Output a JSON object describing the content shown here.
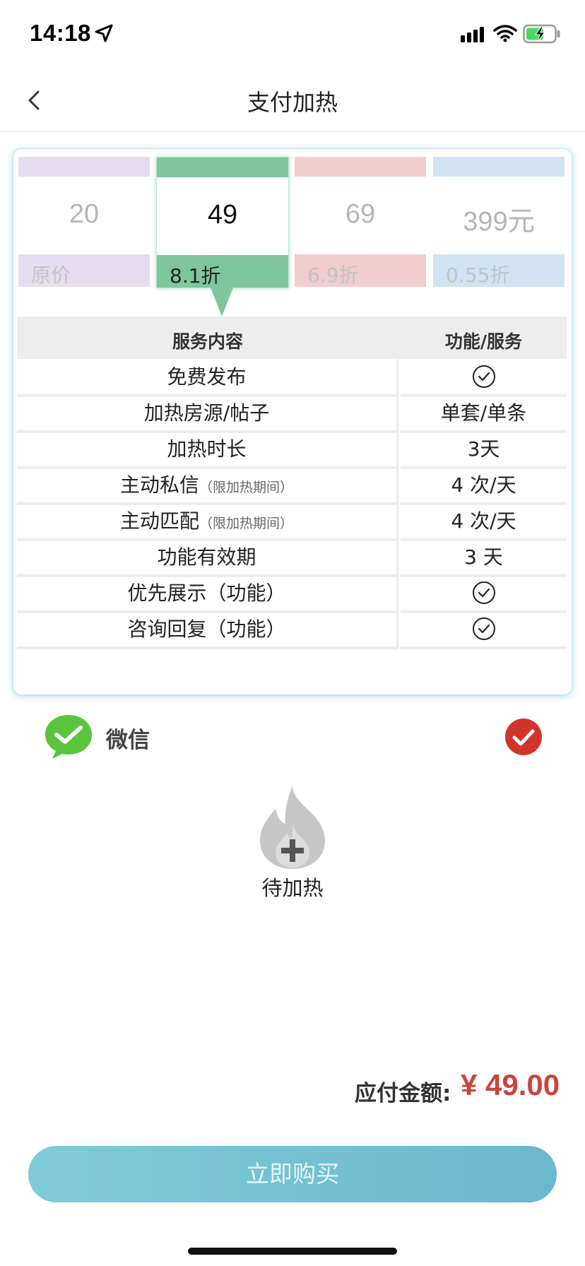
{
  "status_bar": {
    "time": "14:18"
  },
  "nav": {
    "title": "支付加热"
  },
  "tiers": [
    {
      "price": "20",
      "discount": "原价",
      "color_top": "#e6def0",
      "color_bottom": "#e6def0",
      "selected": false
    },
    {
      "price": "49",
      "discount": "8.1折",
      "color_top": "#7fc69c",
      "color_bottom": "#7fc69c",
      "selected": true
    },
    {
      "price": "69",
      "discount": "6.9折",
      "color_top": "#f0cdcf",
      "color_bottom": "#f0cdcf",
      "selected": false
    },
    {
      "price": "399元",
      "discount": "0.55折",
      "color_top": "#cfe3f3",
      "color_bottom": "#cfe3f3",
      "selected": false
    }
  ],
  "table": {
    "headers": [
      "服务内容",
      "功能/服务"
    ],
    "rows": [
      {
        "label": "免费发布",
        "note": "",
        "value": "",
        "check": true
      },
      {
        "label": "加热房源/帖子",
        "note": "",
        "value": "单套/单条",
        "check": false
      },
      {
        "label": "加热时长",
        "note": "",
        "value": "3天",
        "check": false
      },
      {
        "label": "主动私信",
        "note": "（限加热期间）",
        "value": "4 次/天",
        "check": false
      },
      {
        "label": "主动匹配",
        "note": "（限加热期间）",
        "value": "4 次/天",
        "check": false
      },
      {
        "label": "功能有效期",
        "note": "",
        "value": "3 天",
        "check": false
      },
      {
        "label": "优先展示（功能）",
        "note": "",
        "value": "",
        "check": true
      },
      {
        "label": "咨询回复（功能）",
        "note": "",
        "value": "",
        "check": true
      }
    ]
  },
  "payment": {
    "method": "微信",
    "selected": true
  },
  "heat": {
    "label": "待加热"
  },
  "total": {
    "label": "应付金额:",
    "amount": "¥ 49.00"
  },
  "buy_button": {
    "label": "立即购买"
  },
  "colors": {
    "accent": "#6ab8cb",
    "price_red": "#c8453c",
    "wechat_green": "#5ac43f",
    "check_red": "#d0342c"
  }
}
